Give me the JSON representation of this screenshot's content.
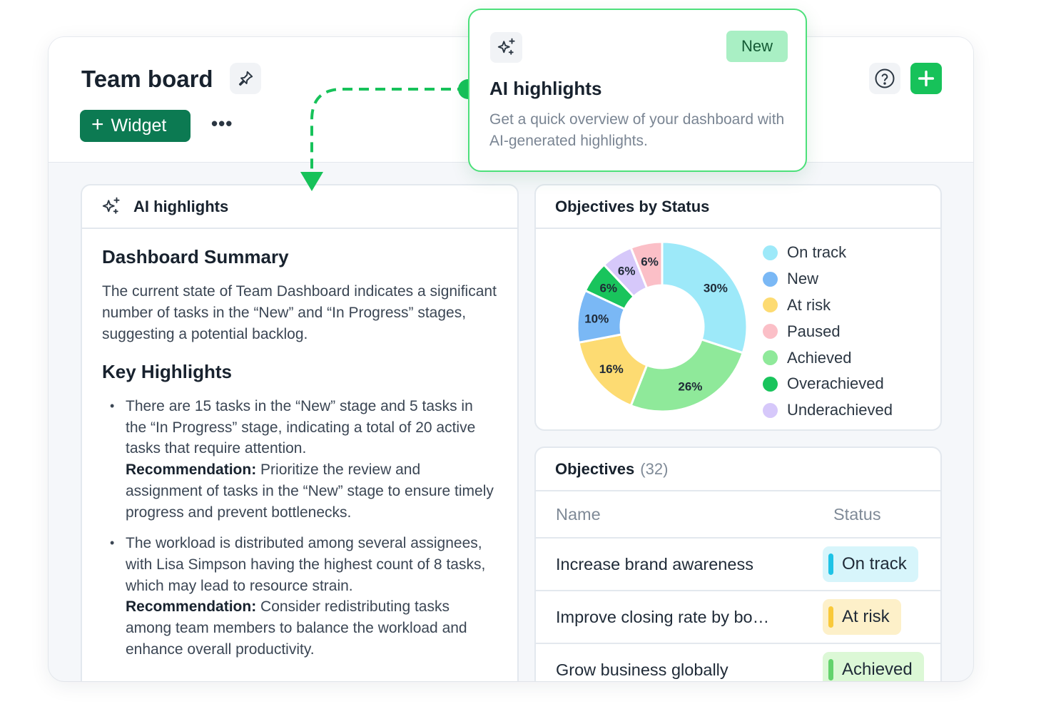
{
  "header": {
    "title": "Team board",
    "widget_label": "Widget",
    "more_label": "•••"
  },
  "popover": {
    "badge": "New",
    "title": "AI highlights",
    "description": "Get a quick overview of your dashboard with AI-generated highlights."
  },
  "ai_card": {
    "title": "AI highlights",
    "summary_heading": "Dashboard Summary",
    "summary_text": "The current state of Team Dashboard indicates a significant number of tasks in the “New” and “In Progress” stages, suggesting a potential backlog.",
    "key_heading": "Key Highlights",
    "bullets": [
      {
        "text": "There are 15 tasks in the “New” stage and 5 tasks in the “In Progress” stage, indicating a total of 20 active tasks that require attention.",
        "rec_label": "Recommendation:",
        "rec_text": " Prioritize the review and assignment of tasks in the “New” stage to ensure timely progress and prevent bottlenecks."
      },
      {
        "text": "The workload is distributed among several assignees, with Lisa Simpson having the highest count of 8 tasks, which may lead to resource strain.",
        "rec_label": "Recommendation:",
        "rec_text": " Consider redistributing tasks among team members to balance the workload and enhance overall productivity."
      }
    ]
  },
  "status_card": {
    "title": "Objectives by Status"
  },
  "chart_data": {
    "type": "pie",
    "variant": "donut",
    "categories": [
      "On track",
      "Achieved",
      "At risk",
      "New",
      "Overachieved",
      "Underachieved",
      "Paused"
    ],
    "values": [
      30,
      26,
      16,
      10,
      6,
      6,
      6
    ],
    "labels": [
      "30%",
      "26%",
      "16%",
      "10%",
      "6%",
      "6%",
      "6%"
    ],
    "colors": [
      "#9de9f9",
      "#8fe99a",
      "#fddb72",
      "#7ab8f5",
      "#19c45c",
      "#d6c8fa",
      "#fbbfc7"
    ],
    "legend": [
      {
        "label": "On track",
        "color": "#9de9f9"
      },
      {
        "label": "New",
        "color": "#7ab8f5"
      },
      {
        "label": "At risk",
        "color": "#fddb72"
      },
      {
        "label": "Paused",
        "color": "#fbbfc7"
      },
      {
        "label": "Achieved",
        "color": "#8fe99a"
      },
      {
        "label": "Overachieved",
        "color": "#19c45c"
      },
      {
        "label": "Underachieved",
        "color": "#d6c8fa"
      }
    ],
    "legend_position": "right"
  },
  "objectives": {
    "title": "Objectives",
    "count": "(32)",
    "columns": [
      "Name",
      "Status"
    ],
    "rows": [
      {
        "name": "Increase brand awareness",
        "status": "On track",
        "bg": "#d7f5fb",
        "bar": "#1ec3e6"
      },
      {
        "name": "Improve closing rate by bo…",
        "status": "At risk",
        "bg": "#fdf0c9",
        "bar": "#f9c93a"
      },
      {
        "name": "Grow business globally",
        "status": "Achieved",
        "bg": "#dcf8d6",
        "bar": "#63d36c"
      }
    ]
  }
}
